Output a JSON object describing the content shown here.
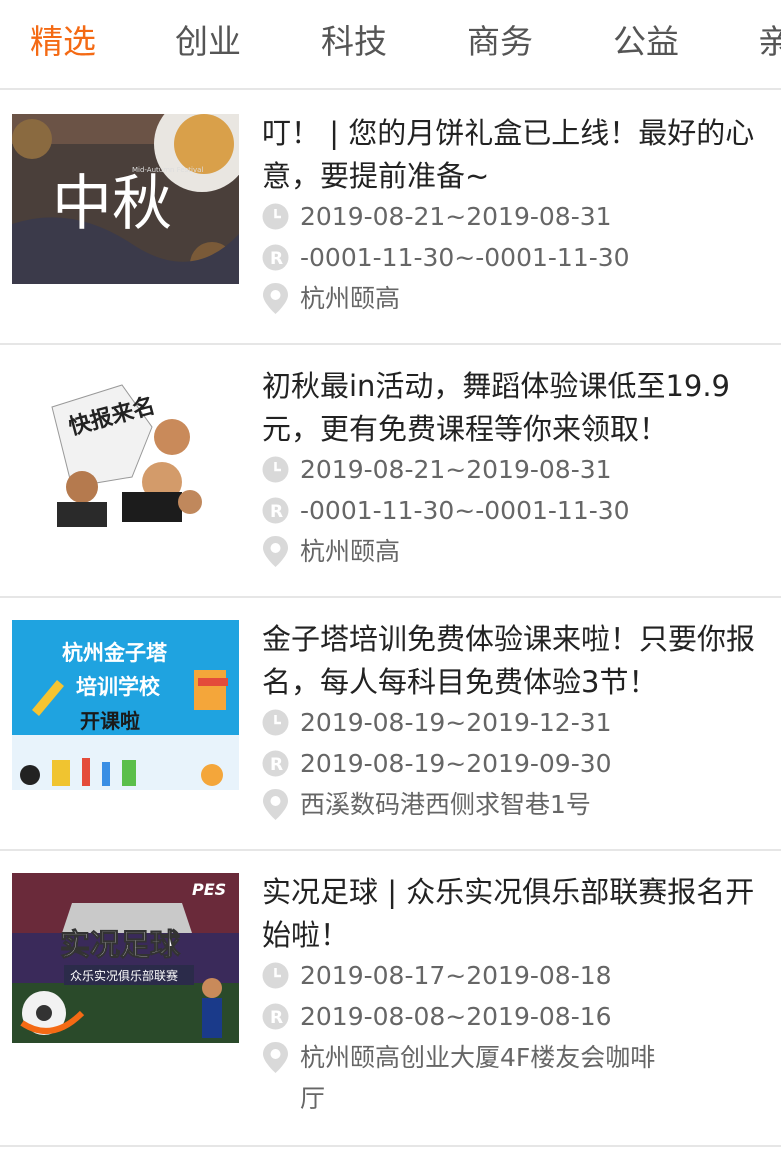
{
  "tabs": [
    {
      "label": "精选",
      "active": true
    },
    {
      "label": "创业",
      "active": false
    },
    {
      "label": "科技",
      "active": false
    },
    {
      "label": "商务",
      "active": false
    },
    {
      "label": "公益",
      "active": false
    },
    {
      "label": "亲",
      "active": false
    }
  ],
  "accent_color": "#f46a14",
  "icon_color": "#d9d9d9",
  "events": [
    {
      "title": "叮！ | 您的月饼礼盒已上线！最好的心意，要提前准备~",
      "image_text": "中秋",
      "image_subtitle": "Mid-Autumn Festival",
      "event_time": "2019-08-21~2019-08-31",
      "register_time": "-0001-11-30~-0001-11-30",
      "location": "杭州颐高"
    },
    {
      "title": "初秋最in活动，舞蹈体验课低至19.9元，更有免费课程等你来领取！",
      "image_text": "快报来名",
      "event_time": "2019-08-21~2019-08-31",
      "register_time": "-0001-11-30~-0001-11-30",
      "location": "杭州颐高"
    },
    {
      "title": "金子塔培训免费体验课来啦！只要你报名，每人每科目免费体验3节！",
      "image_lines": [
        "杭州金子塔",
        "培训学校",
        "开课啦"
      ],
      "event_time": "2019-08-19~2019-12-31",
      "register_time": "2019-08-19~2019-09-30",
      "location": "西溪数码港西侧求智巷1号"
    },
    {
      "title": "实况足球 | 众乐实况俱乐部联赛报名开始啦！",
      "image_text": "实况足球",
      "image_subtitle": "众乐实况俱乐部联赛",
      "image_brand": "PES",
      "event_time": "2019-08-17~2019-08-18",
      "register_time": "2019-08-08~2019-08-16",
      "location": "杭州颐高创业大厦4F楼友会咖啡厅"
    }
  ]
}
